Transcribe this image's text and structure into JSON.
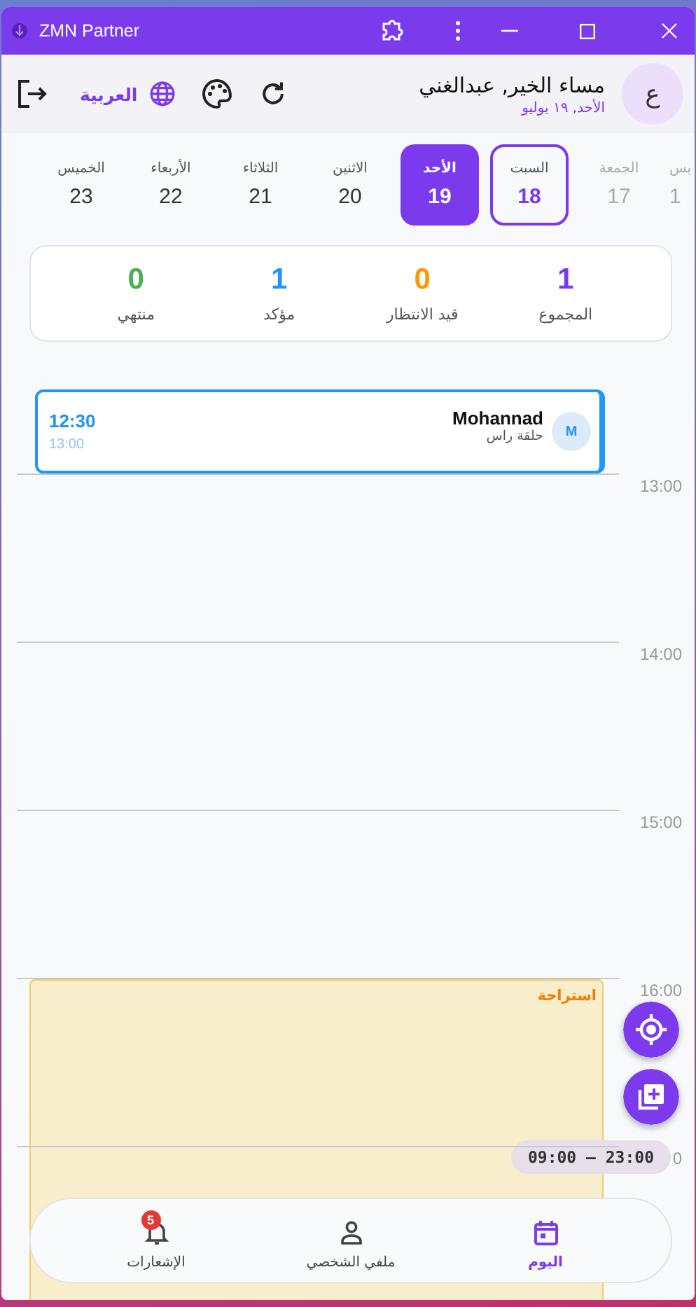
{
  "window": {
    "title": "ZMN Partner"
  },
  "header": {
    "avatar": "ع",
    "greeting": "مساء الخير, عبدالغني",
    "date": "الأحد, ١٩ يوليو",
    "language": "العربية"
  },
  "days": [
    {
      "name": "يس",
      "number": "1",
      "selected": false,
      "today": false,
      "past": true
    },
    {
      "name": "الجمعة",
      "number": "17",
      "selected": false,
      "today": false,
      "past": true
    },
    {
      "name": "السبت",
      "number": "18",
      "selected": false,
      "today": true,
      "past": false
    },
    {
      "name": "الأحد",
      "number": "19",
      "selected": true,
      "today": false,
      "past": false
    },
    {
      "name": "الاثنين",
      "number": "20",
      "selected": false,
      "today": false,
      "past": false
    },
    {
      "name": "الثلاثاء",
      "number": "21",
      "selected": false,
      "today": false,
      "past": false
    },
    {
      "name": "الأربعاء",
      "number": "22",
      "selected": false,
      "today": false,
      "past": false
    },
    {
      "name": "الخميس",
      "number": "23",
      "selected": false,
      "today": false,
      "past": false
    }
  ],
  "stats": [
    {
      "value": "1",
      "label": "المجموع",
      "color": "#7c3aed"
    },
    {
      "value": "0",
      "label": "قيد الانتظار",
      "color": "#ff9800"
    },
    {
      "value": "1",
      "label": "مؤكد",
      "color": "#2196f3"
    },
    {
      "value": "0",
      "label": "منتهي",
      "color": "#4caf50"
    }
  ],
  "appointments": [
    {
      "initial": "M",
      "customer": "Mohannad",
      "service": "حلقة راس",
      "start": "12:30",
      "end": "13:00"
    }
  ],
  "hours": [
    {
      "time": "13:00"
    },
    {
      "time": "14:00"
    },
    {
      "time": "15:00"
    },
    {
      "time": "16:00",
      "break_label": "استراحة"
    },
    {
      "time": "0"
    }
  ],
  "working_hours": "09:00 – 23:00",
  "nav": [
    {
      "kind": "calendar",
      "label": "اليوم",
      "selected": true
    },
    {
      "kind": "person",
      "label": "ملفي الشخصي",
      "selected": false
    },
    {
      "kind": "bell",
      "label": "الإشعارات",
      "selected": false,
      "badge": "5"
    }
  ]
}
